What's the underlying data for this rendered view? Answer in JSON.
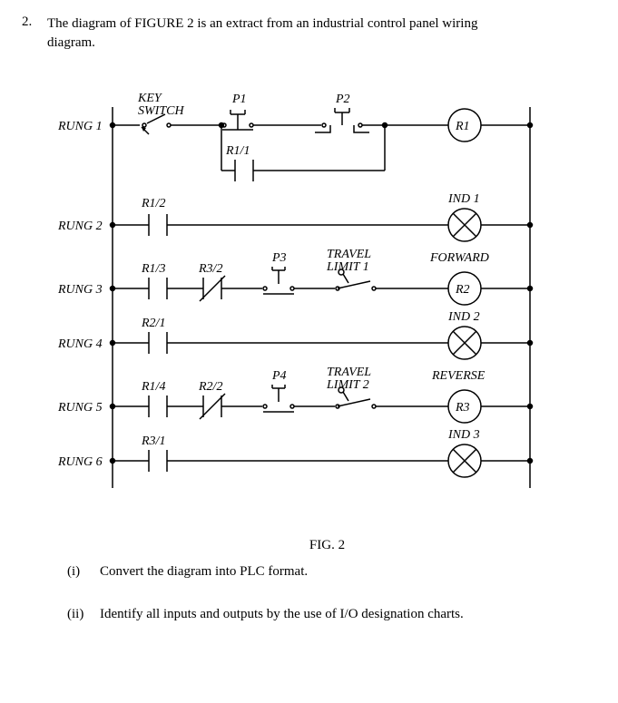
{
  "question": {
    "number": "2.",
    "text": "The diagram of FIGURE 2 is an extract from an industrial control panel wiring diagram."
  },
  "rung_labels": [
    "RUNG 1",
    "RUNG 2",
    "RUNG 3",
    "RUNG 4",
    "RUNG 5",
    "RUNG 6"
  ],
  "rung1": {
    "key_switch": "KEY SWITCH",
    "p1": "P1",
    "p2": "P2",
    "r1": "R1",
    "r11": "R1/1"
  },
  "rung2": {
    "r12": "R1/2",
    "ind1": "IND 1"
  },
  "rung3": {
    "r13": "R1/3",
    "r32": "R3/2",
    "p3": "P3",
    "tl1": "TRAVEL LIMIT 1",
    "fwd": "FORWARD",
    "r2": "R2"
  },
  "rung4": {
    "r21": "R2/1",
    "ind2": "IND 2"
  },
  "rung5": {
    "r14": "R1/4",
    "r22": "R2/2",
    "p4": "P4",
    "tl2": "TRAVEL LIMIT 2",
    "rev": "REVERSE",
    "r3": "R3"
  },
  "rung6": {
    "r31": "R3/1",
    "ind3": "IND 3"
  },
  "fig_caption": "FIG. 2",
  "subparts": {
    "i_num": "(i)",
    "i_text": "Convert the diagram into PLC format.",
    "ii_num": "(ii)",
    "ii_text": "Identify all inputs and outputs by the use of I/O designation charts."
  },
  "chart_data": {
    "type": "ladder-diagram",
    "rungs": [
      {
        "id": 1,
        "main": [
          {
            "type": "key-switch",
            "label": "KEY SWITCH"
          },
          {
            "type": "pushbutton-nc",
            "label": "P1"
          },
          {
            "type": "pushbutton-no",
            "label": "P2"
          },
          {
            "type": "coil",
            "label": "R1"
          }
        ],
        "seal_in": {
          "from_after": "P1",
          "contact": {
            "type": "no",
            "label": "R1/1"
          },
          "joins_after": "P2"
        }
      },
      {
        "id": 2,
        "main": [
          {
            "type": "no",
            "label": "R1/2"
          },
          {
            "type": "lamp",
            "label": "IND 1"
          }
        ]
      },
      {
        "id": 3,
        "main": [
          {
            "type": "no",
            "label": "R1/3"
          },
          {
            "type": "nc",
            "label": "R3/2"
          },
          {
            "type": "pushbutton-no",
            "label": "P3"
          },
          {
            "type": "limit-nc",
            "label": "TRAVEL LIMIT 1"
          },
          {
            "type": "coil",
            "label": "R2",
            "annotation": "FORWARD"
          }
        ]
      },
      {
        "id": 4,
        "main": [
          {
            "type": "no",
            "label": "R2/1"
          },
          {
            "type": "lamp",
            "label": "IND 2"
          }
        ]
      },
      {
        "id": 5,
        "main": [
          {
            "type": "no",
            "label": "R1/4"
          },
          {
            "type": "nc",
            "label": "R2/2"
          },
          {
            "type": "pushbutton-no",
            "label": "P4"
          },
          {
            "type": "limit-nc",
            "label": "TRAVEL LIMIT 2"
          },
          {
            "type": "coil",
            "label": "R3",
            "annotation": "REVERSE"
          }
        ]
      },
      {
        "id": 6,
        "main": [
          {
            "type": "no",
            "label": "R3/1"
          },
          {
            "type": "lamp",
            "label": "IND 3"
          }
        ]
      }
    ]
  }
}
